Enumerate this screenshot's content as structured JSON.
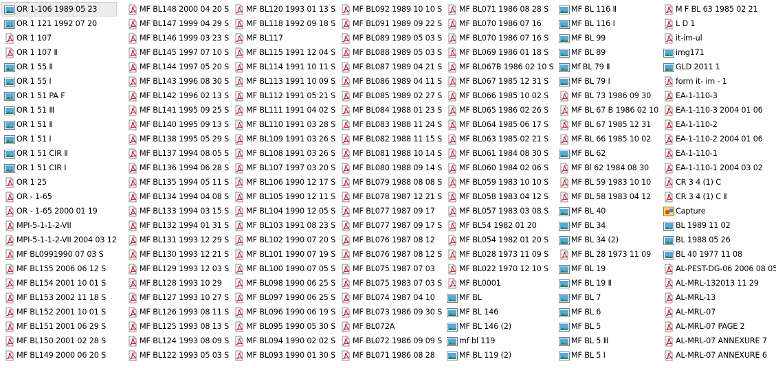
{
  "explorer": {
    "selected": "OR 1-106 1989 05 23",
    "columns": [
      [
        {
          "name": "OR 1-106 1989 05 23",
          "icon": "image-file-icon"
        },
        {
          "name": "OR 1 121 1992 07 20",
          "icon": "image-file-icon"
        },
        {
          "name": "OR 1 107",
          "icon": "pdf-file-icon"
        },
        {
          "name": "OR 1 107 Ⅱ",
          "icon": "pdf-file-icon"
        },
        {
          "name": "OR 1 55 Ⅱ",
          "icon": "image-file-icon"
        },
        {
          "name": "OR 1 55 I",
          "icon": "image-file-icon"
        },
        {
          "name": "OR 1 51 PA F",
          "icon": "image-file-icon"
        },
        {
          "name": "OR 1 51 Ⅲ",
          "icon": "image-file-icon"
        },
        {
          "name": "OR 1 51 Ⅱ",
          "icon": "image-file-icon"
        },
        {
          "name": "OR 1 51 I",
          "icon": "image-file-icon"
        },
        {
          "name": "OR 1 51 CIR Ⅱ",
          "icon": "image-file-icon"
        },
        {
          "name": "OR 1 51 CIR I",
          "icon": "image-file-icon"
        },
        {
          "name": "OR 1 25",
          "icon": "pdf-file-icon"
        },
        {
          "name": "OR - 1-65",
          "icon": "pdf-file-icon"
        },
        {
          "name": "OR - 1-65 2000 01 19",
          "icon": "pdf-file-icon"
        },
        {
          "name": "MPI-5-1-1-2-VII",
          "icon": "pdf-file-icon"
        },
        {
          "name": "MPI-5-1-1-2-VII 2004 03 12",
          "icon": "pdf-file-icon"
        },
        {
          "name": "MF BL0991990 07 03 S",
          "icon": "pdf-file-icon"
        },
        {
          "name": "MF BL155 2006 06 12 S",
          "icon": "pdf-file-icon"
        },
        {
          "name": "MF BL154 2001 10 01 S",
          "icon": "pdf-file-icon"
        },
        {
          "name": "MF BL153 2002 11 18 S",
          "icon": "pdf-file-icon"
        },
        {
          "name": "MF BL152 2001 10 01 S",
          "icon": "pdf-file-icon"
        },
        {
          "name": "MF BL151 2001 06 29 S",
          "icon": "pdf-file-icon"
        },
        {
          "name": "MF BL150 2001 02 28 S",
          "icon": "pdf-file-icon"
        },
        {
          "name": "MF BL149 2000 06 20 S",
          "icon": "pdf-file-icon"
        }
      ],
      [
        {
          "name": "MF BL148 2000 04 20 S",
          "icon": "pdf-file-icon"
        },
        {
          "name": "MF BL147 1999 04 29 S",
          "icon": "pdf-file-icon"
        },
        {
          "name": "MF BL146 1999 03 23 S",
          "icon": "pdf-file-icon"
        },
        {
          "name": "MF BL145 1997 07 10 S",
          "icon": "pdf-file-icon"
        },
        {
          "name": "MF BL144 1997 05 20 S",
          "icon": "pdf-file-icon"
        },
        {
          "name": "MF BL143 1996 08 30 S",
          "icon": "pdf-file-icon"
        },
        {
          "name": "MF BL142 1996 02 13 S",
          "icon": "pdf-file-icon"
        },
        {
          "name": "MF BL141 1995 09 25 S",
          "icon": "pdf-file-icon"
        },
        {
          "name": "MF BL140 1995 09 13 S",
          "icon": "pdf-file-icon"
        },
        {
          "name": "MF BL138 1995 05 29 S",
          "icon": "pdf-file-icon"
        },
        {
          "name": "MF BL137 1994 08 05 S",
          "icon": "pdf-file-icon"
        },
        {
          "name": "MF BL136 1994 06 28 S",
          "icon": "pdf-file-icon"
        },
        {
          "name": "MF BL135 1994 05 11 S",
          "icon": "pdf-file-icon"
        },
        {
          "name": "MF BL134 1994 04 08 S",
          "icon": "pdf-file-icon"
        },
        {
          "name": "MF BL133 1994 03 15 S",
          "icon": "pdf-file-icon"
        },
        {
          "name": "MF BL132 1994 01 31 S",
          "icon": "pdf-file-icon"
        },
        {
          "name": "MF BL131 1993 12 29 S",
          "icon": "pdf-file-icon"
        },
        {
          "name": "MF BL130 1993 12 21 S",
          "icon": "pdf-file-icon"
        },
        {
          "name": "MF BL129 1993 12 03 S",
          "icon": "pdf-file-icon"
        },
        {
          "name": "MF BL128 1993 10 29",
          "icon": "pdf-file-icon"
        },
        {
          "name": "MF BL127 1993 10 27 S",
          "icon": "pdf-file-icon"
        },
        {
          "name": "MF BL126 1993 08 11 S",
          "icon": "pdf-file-icon"
        },
        {
          "name": "MF BL125 1993 08 13 S",
          "icon": "pdf-file-icon"
        },
        {
          "name": "MF BL124 1993 08 09 S",
          "icon": "pdf-file-icon"
        },
        {
          "name": "MF BL122 1993 05 03 S",
          "icon": "pdf-file-icon"
        }
      ],
      [
        {
          "name": "MF BL120 1993 01 13 S",
          "icon": "pdf-file-icon"
        },
        {
          "name": "MF BL118 1992 09 18 S",
          "icon": "pdf-file-icon"
        },
        {
          "name": "MF BL117",
          "icon": "pdf-file-icon"
        },
        {
          "name": "MF BL115 1991 12 04 S",
          "icon": "pdf-file-icon"
        },
        {
          "name": "MF BL114 1991 10 11 S",
          "icon": "pdf-file-icon"
        },
        {
          "name": "MF BL113 1991 10 09 S",
          "icon": "pdf-file-icon"
        },
        {
          "name": "MF BL112 1991 05 21 S",
          "icon": "pdf-file-icon"
        },
        {
          "name": "MF BL111 1991 04 02 S",
          "icon": "pdf-file-icon"
        },
        {
          "name": "MF BL110 1991 03 28 S",
          "icon": "pdf-file-icon"
        },
        {
          "name": "MF BL109 1991 03 26 S",
          "icon": "pdf-file-icon"
        },
        {
          "name": "MF BL108 1991 03 26 S",
          "icon": "pdf-file-icon"
        },
        {
          "name": "MF BL107 1997 03 20 S",
          "icon": "pdf-file-icon"
        },
        {
          "name": "MF BL106 1990 12 17 S",
          "icon": "pdf-file-icon"
        },
        {
          "name": "MF BL105 1990 12 11 S",
          "icon": "pdf-file-icon"
        },
        {
          "name": "MF BL104 1990 12 05 S",
          "icon": "pdf-file-icon"
        },
        {
          "name": "MF BL103 1991 08 23 S",
          "icon": "pdf-file-icon"
        },
        {
          "name": "MF BL102 1990 07 20 S",
          "icon": "pdf-file-icon"
        },
        {
          "name": "MF BL101 1990 07 19 S",
          "icon": "pdf-file-icon"
        },
        {
          "name": "MF BL100 1990 07 05 S",
          "icon": "pdf-file-icon"
        },
        {
          "name": "MF BL098 1990 06 25 S",
          "icon": "pdf-file-icon"
        },
        {
          "name": "MF BL097 1990 06 25 S",
          "icon": "pdf-file-icon"
        },
        {
          "name": "MF BL096 1990 06 19 S",
          "icon": "pdf-file-icon"
        },
        {
          "name": "MF BL095 1990 05 30 S",
          "icon": "pdf-file-icon"
        },
        {
          "name": "MF BL094 1990 02 02 S",
          "icon": "pdf-file-icon"
        },
        {
          "name": "MF BL093 1990 01 30 S",
          "icon": "pdf-file-icon"
        }
      ],
      [
        {
          "name": "MF BL092 1989 10 10 S",
          "icon": "pdf-file-icon"
        },
        {
          "name": "MF BL091 1989 09 22 S",
          "icon": "pdf-file-icon"
        },
        {
          "name": "MF BL089 1989 05 03 S",
          "icon": "pdf-file-icon"
        },
        {
          "name": "MF BL088 1989 05 03 S",
          "icon": "pdf-file-icon"
        },
        {
          "name": "MF BL087 1989 04 21 S",
          "icon": "pdf-file-icon"
        },
        {
          "name": "MF BL086 1989 04 11 S",
          "icon": "pdf-file-icon"
        },
        {
          "name": "MF BL085 1989 02 27 S",
          "icon": "pdf-file-icon"
        },
        {
          "name": "MF BL084 1988 01 23 S",
          "icon": "pdf-file-icon"
        },
        {
          "name": "MF BL083 1988 11 24 S",
          "icon": "pdf-file-icon"
        },
        {
          "name": "MF BL082 1988 11 15 S",
          "icon": "pdf-file-icon"
        },
        {
          "name": "MF BL081 1988 10 14 S",
          "icon": "pdf-file-icon"
        },
        {
          "name": "MF BL080 1988 09 14 S",
          "icon": "pdf-file-icon"
        },
        {
          "name": "MF BL079 1988 08 08 S",
          "icon": "pdf-file-icon"
        },
        {
          "name": "MF BL078 1987 12 21 S",
          "icon": "pdf-file-icon"
        },
        {
          "name": "MF BL077 1987 09 17",
          "icon": "pdf-file-icon"
        },
        {
          "name": "MF BL077 1987 09 17 S",
          "icon": "pdf-file-icon"
        },
        {
          "name": "MF BL076 1987 08 12",
          "icon": "pdf-file-icon"
        },
        {
          "name": "MF BL076 1987 08 12 S",
          "icon": "pdf-file-icon"
        },
        {
          "name": "MF BL075 1987 07 03",
          "icon": "pdf-file-icon"
        },
        {
          "name": "MF BL075 1983 07 03 S",
          "icon": "pdf-file-icon"
        },
        {
          "name": "MF BL074 1987 04 10",
          "icon": "pdf-file-icon"
        },
        {
          "name": "MF BL073 1986 09 30 S",
          "icon": "pdf-file-icon"
        },
        {
          "name": "MF BL072A",
          "icon": "pdf-file-icon"
        },
        {
          "name": "MF BL072 1986 09 09 S",
          "icon": "pdf-file-icon"
        },
        {
          "name": "MF BL071 1986 08 28",
          "icon": "pdf-file-icon"
        }
      ],
      [
        {
          "name": "MF BL071 1986 08 28 S",
          "icon": "pdf-file-icon"
        },
        {
          "name": "MF BL070 1986 07 16",
          "icon": "pdf-file-icon"
        },
        {
          "name": "MF BL070 1986 07 16 S",
          "icon": "pdf-file-icon"
        },
        {
          "name": "MF BL069 1986 01 18 S",
          "icon": "pdf-file-icon"
        },
        {
          "name": "MF BL067B 1986 02 10 S",
          "icon": "pdf-file-icon"
        },
        {
          "name": "MF BL067 1985 12 31 S",
          "icon": "pdf-file-icon"
        },
        {
          "name": "MF BL066 1985 10 02 S",
          "icon": "pdf-file-icon"
        },
        {
          "name": "MF BL065 1986 02 26 S",
          "icon": "pdf-file-icon"
        },
        {
          "name": "MF BL064 1985 06 17 S",
          "icon": "pdf-file-icon"
        },
        {
          "name": "MF BL063 1985 02 21 S",
          "icon": "pdf-file-icon"
        },
        {
          "name": "MF BL061 1984 08 30 S",
          "icon": "pdf-file-icon"
        },
        {
          "name": "MF BL060 1984 02 06 S",
          "icon": "pdf-file-icon"
        },
        {
          "name": "MF BL059 1983 10 10 S",
          "icon": "pdf-file-icon"
        },
        {
          "name": "MF BL058 1983 04 12 S",
          "icon": "pdf-file-icon"
        },
        {
          "name": "MF BL057 1983 03 08 S",
          "icon": "pdf-file-icon"
        },
        {
          "name": "MF BL54 1982 01 20",
          "icon": "pdf-file-icon"
        },
        {
          "name": "MF BL054 1982 01 20 S",
          "icon": "pdf-file-icon"
        },
        {
          "name": "MF BL028 1973 11 09 S",
          "icon": "pdf-file-icon"
        },
        {
          "name": "MF BL022 1970 12 10 S",
          "icon": "pdf-file-icon"
        },
        {
          "name": "MF BL0001",
          "icon": "pdf-file-icon"
        },
        {
          "name": "MF BL",
          "icon": "image-file-icon"
        },
        {
          "name": "MF BL 146",
          "icon": "image-file-icon"
        },
        {
          "name": "MF BL 146 (2)",
          "icon": "image-file-icon"
        },
        {
          "name": "mf bl 119",
          "icon": "image-file-icon"
        },
        {
          "name": "MF BL 119 (2)",
          "icon": "image-file-icon"
        }
      ],
      [
        {
          "name": "MF BL 116 Ⅱ",
          "icon": "image-file-icon"
        },
        {
          "name": "MF BL 116 I",
          "icon": "image-file-icon"
        },
        {
          "name": "MF BL 99",
          "icon": "image-file-icon"
        },
        {
          "name": "MF BL 89",
          "icon": "image-file-icon"
        },
        {
          "name": "Mf BL 79 Ⅱ",
          "icon": "image-file-icon"
        },
        {
          "name": "MF BL 79 I",
          "icon": "image-file-icon"
        },
        {
          "name": "MF BL 73 1986 09 30",
          "icon": "pdf-file-icon"
        },
        {
          "name": "MF BL 67 B 1986 02 10",
          "icon": "pdf-file-icon"
        },
        {
          "name": "MF BL 67 1985 12 31",
          "icon": "pdf-file-icon"
        },
        {
          "name": "MF BL 66 1985 10 02",
          "icon": "pdf-file-icon"
        },
        {
          "name": "MF BL 62",
          "icon": "image-file-icon"
        },
        {
          "name": "MF Bl 62 1984 08 30",
          "icon": "pdf-file-icon"
        },
        {
          "name": "MF BL 59 1983 10 10",
          "icon": "pdf-file-icon"
        },
        {
          "name": "MF BL 58 1983 04 12",
          "icon": "pdf-file-icon"
        },
        {
          "name": "MF BL 40",
          "icon": "image-file-icon"
        },
        {
          "name": "MF BL 34",
          "icon": "image-file-icon"
        },
        {
          "name": "MF BL 34 (2)",
          "icon": "image-file-icon"
        },
        {
          "name": "MF BL 28 1973 11 09",
          "icon": "pdf-file-icon"
        },
        {
          "name": "MF BL 19",
          "icon": "image-file-icon"
        },
        {
          "name": "MF BL 19 Ⅱ",
          "icon": "image-file-icon"
        },
        {
          "name": "MF BL 7",
          "icon": "image-file-icon"
        },
        {
          "name": "MF BL 6",
          "icon": "image-file-icon"
        },
        {
          "name": "MF BL 5",
          "icon": "image-file-icon"
        },
        {
          "name": "MF BL 5 Ⅲ",
          "icon": "image-file-icon"
        },
        {
          "name": "MF BL 5 I",
          "icon": "image-file-icon"
        }
      ],
      [
        {
          "name": "M F BL 63 1985 02 21",
          "icon": "pdf-file-icon"
        },
        {
          "name": "L D 1",
          "icon": "pdf-file-icon"
        },
        {
          "name": "it-im-ul",
          "icon": "pdf-file-icon"
        },
        {
          "name": "img171",
          "icon": "image-file-icon"
        },
        {
          "name": "GLD 2011 1",
          "icon": "image-file-icon"
        },
        {
          "name": "form it- im - 1",
          "icon": "pdf-file-icon"
        },
        {
          "name": "EA-1-110-3",
          "icon": "pdf-file-icon"
        },
        {
          "name": "EA-1-110-3 2004 01 06",
          "icon": "pdf-file-icon"
        },
        {
          "name": "EA-1-110-2",
          "icon": "pdf-file-icon"
        },
        {
          "name": "EA-1-110-2 2004 01 06",
          "icon": "pdf-file-icon"
        },
        {
          "name": "EA-1-110-1",
          "icon": "pdf-file-icon"
        },
        {
          "name": "EA-1-110-1 2004 03 02",
          "icon": "pdf-file-icon"
        },
        {
          "name": "CR 3 4 (1) C",
          "icon": "pdf-file-icon"
        },
        {
          "name": "CR 3 4 (1) C  Ⅱ",
          "icon": "pdf-file-icon"
        },
        {
          "name": "Capture",
          "icon": "capture-image-icon"
        },
        {
          "name": "BL 1989 11 02",
          "icon": "image-file-icon"
        },
        {
          "name": "BL 1988 05 26",
          "icon": "image-file-icon"
        },
        {
          "name": "BL 40 1977 11 08",
          "icon": "image-file-icon"
        },
        {
          "name": "AL-PEST-DG-06 2006 08 05",
          "icon": "pdf-file-icon"
        },
        {
          "name": "AL-MRL-132013 11 29",
          "icon": "pdf-file-icon"
        },
        {
          "name": "AL-MRL-13",
          "icon": "pdf-file-icon"
        },
        {
          "name": "AL-MRL-07",
          "icon": "pdf-file-icon"
        },
        {
          "name": "AL-MRL-07 PAGE 2",
          "icon": "pdf-file-icon"
        },
        {
          "name": "AL-MRL-07 ANNEXURE 7",
          "icon": "pdf-file-icon"
        },
        {
          "name": "AL-MRL-07 ANNEXURE 6",
          "icon": "pdf-file-icon"
        }
      ]
    ]
  },
  "colors": {
    "pdf_icon": "#c8252c",
    "image_icon_border": "#6b7c8f",
    "image_icon_sky": "#5aa9d8",
    "selection_bg": "#ececec"
  }
}
